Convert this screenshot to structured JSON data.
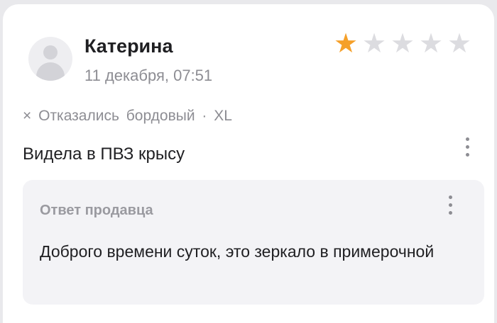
{
  "review": {
    "author": "Катерина",
    "date": "11 декабря, 07:51",
    "rating": 1,
    "rating_max": 5,
    "star_glyph": "★",
    "accent_color": "#f5a02a",
    "variant": {
      "icon": "×",
      "status": "Отказались",
      "color": "бордовый",
      "separator": "·",
      "size": "XL"
    },
    "text": "Видела в ПВЗ крысу"
  },
  "seller_reply": {
    "title": "Ответ продавца",
    "text": "Доброго времени суток, это зеркало в примерочной"
  }
}
